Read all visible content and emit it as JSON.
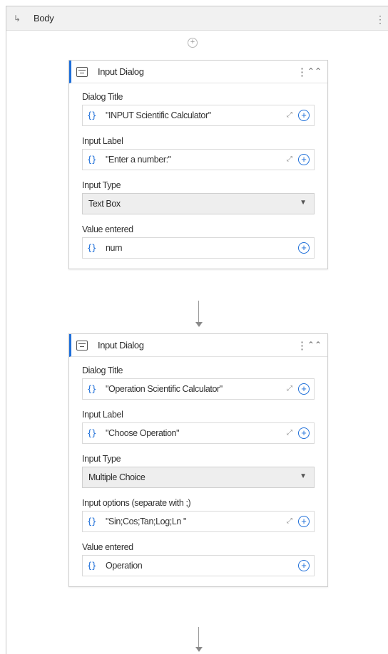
{
  "body_header": {
    "arrow_icon": "↳",
    "title": "Body",
    "more_icon": "⋮"
  },
  "add_activity_icon": "⊕",
  "cards": [
    {
      "title": "Input Dialog",
      "fields": {
        "dialog_title_label": "Dialog Title",
        "dialog_title_value": "\"INPUT Scientific Calculator\"",
        "input_label_label": "Input Label",
        "input_label_value": "\"Enter a number:\"",
        "input_type_label": "Input Type",
        "input_type_value": "Text Box",
        "value_entered_label": "Value entered",
        "value_entered_value": "num"
      }
    },
    {
      "title": "Input Dialog",
      "fields": {
        "dialog_title_label": "Dialog Title",
        "dialog_title_value": "\"Operation Scientific Calculator\"",
        "input_label_label": "Input Label",
        "input_label_value": "\"Choose Operation\"",
        "input_type_label": "Input Type",
        "input_type_value": "Multiple Choice",
        "input_options_label": "Input options (separate with ;)",
        "input_options_value": "\"Sin;Cos;Tan;Log;Ln \"",
        "value_entered_label": "Value entered",
        "value_entered_value": "Operation"
      }
    }
  ],
  "glyphs": {
    "brace": "{}",
    "kebab": "⋮",
    "collapse": "≈",
    "expand": "⤢",
    "plus": "+",
    "chevron": "⌄"
  },
  "colors": {
    "accent": "#1e6fd9"
  }
}
